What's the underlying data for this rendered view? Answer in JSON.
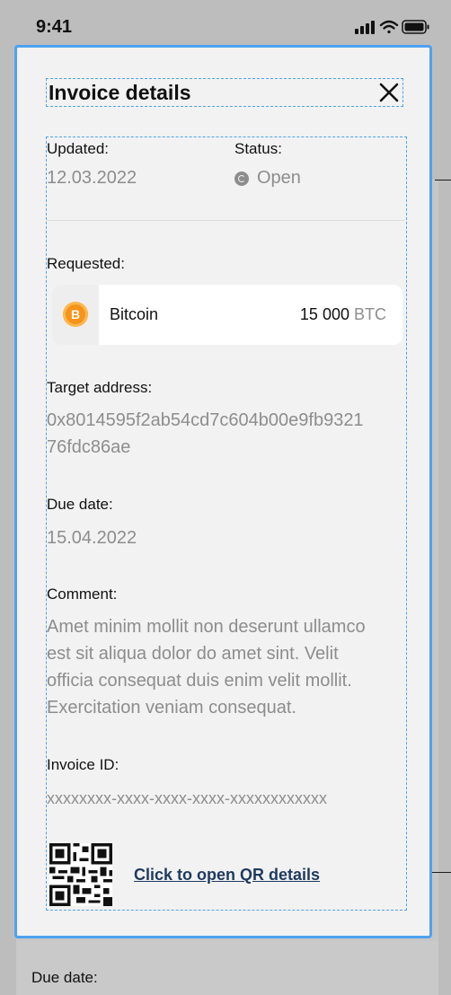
{
  "status_bar": {
    "time": "9:41"
  },
  "modal": {
    "title": "Invoice details",
    "updated": {
      "label": "Updated:",
      "value": "12.03.2022"
    },
    "status": {
      "label": "Status:",
      "value": "Open",
      "icon": "refresh-icon"
    },
    "requested": {
      "label": "Requested:",
      "coin_name": "Bitcoin",
      "coin_symbol": "B",
      "amount": "15 000",
      "currency": "BTC",
      "icon": "bitcoin-icon"
    },
    "target_address": {
      "label": "Target address:",
      "line1": "0x8014595f2ab54cd7c604b00e9fb9321",
      "line2": "76fdc86ae"
    },
    "due_date": {
      "label": "Due date:",
      "value": "15.04.2022"
    },
    "comment": {
      "label": "Comment:",
      "lines": [
        "Amet minim mollit non deserunt ullamco",
        "est sit aliqua dolor do amet sint. Velit",
        "officia consequat duis enim velit mollit.",
        "Exercitation veniam consequat."
      ]
    },
    "invoice_id": {
      "label": "Invoice ID:",
      "value": "xxxxxxxx-xxxx-xxxx-xxxx-xxxxxxxxxxxx"
    },
    "qr_link": "Click to open QR details"
  },
  "background": {
    "due_date_label": "Due date:"
  },
  "colors": {
    "accent_border": "#4da2f0",
    "muted_text": "#8d8d8d",
    "link": "#1e3a5f",
    "bitcoin": "#f7931a"
  }
}
